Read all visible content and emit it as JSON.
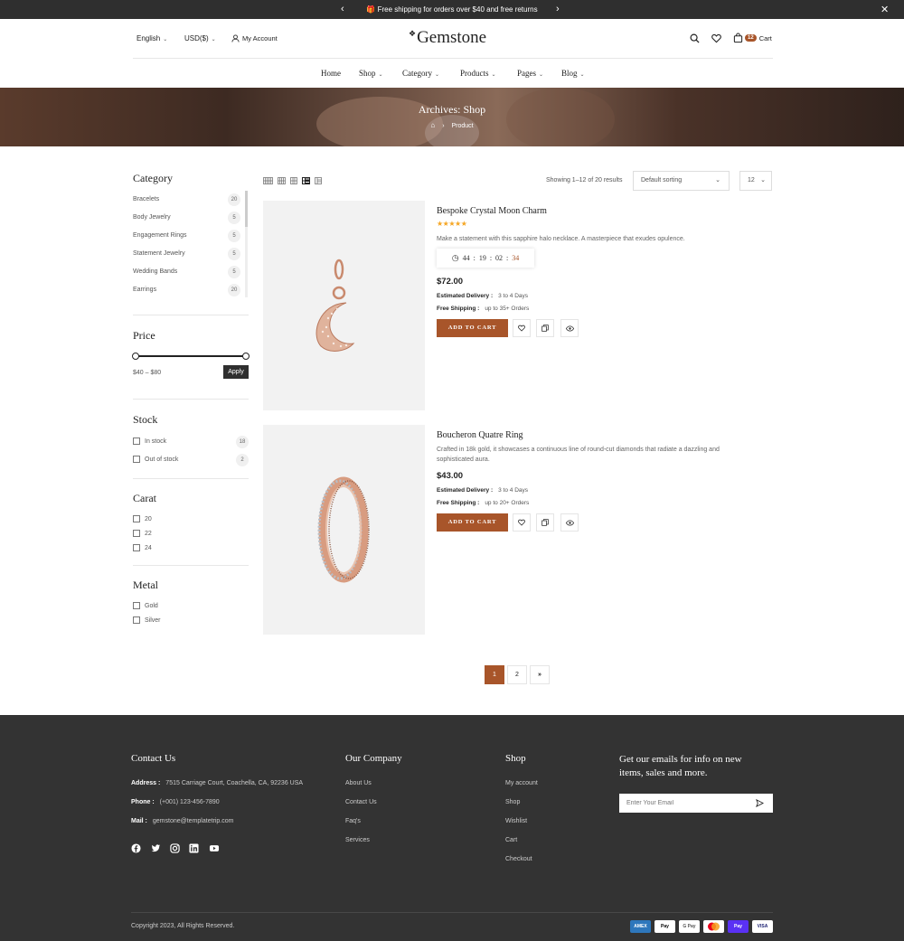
{
  "topbar": {
    "message": "Free shipping for orders over $40 and free returns"
  },
  "header": {
    "language": "English",
    "currency": "USD($)",
    "account": "My Account",
    "logo": "Gemstone",
    "cart_count": "12",
    "cart_label": "Cart"
  },
  "nav": [
    {
      "label": "Home"
    },
    {
      "label": "Shop"
    },
    {
      "label": "Category"
    },
    {
      "label": "Products"
    },
    {
      "label": "Pages"
    },
    {
      "label": "Blog"
    }
  ],
  "hero": {
    "title": "Archives: Shop",
    "breadcrumb_current": "Product"
  },
  "sidebar": {
    "category_title": "Category",
    "categories": [
      {
        "name": "Bracelets",
        "count": "20"
      },
      {
        "name": "Body Jewelry",
        "count": "5"
      },
      {
        "name": "Engagement Rings",
        "count": "5"
      },
      {
        "name": "Statement Jewelry",
        "count": "5"
      },
      {
        "name": "Wedding Bands",
        "count": "5"
      },
      {
        "name": "Earrings",
        "count": "20"
      }
    ],
    "price_title": "Price",
    "price_range": "$40 – $80",
    "apply_label": "Apply",
    "stock_title": "Stock",
    "stock": [
      {
        "name": "In stock",
        "count": "18"
      },
      {
        "name": "Out of stock",
        "count": "2"
      }
    ],
    "carat_title": "Carat",
    "carat": [
      "20",
      "22",
      "24"
    ],
    "metal_title": "Metal",
    "metal": [
      "Gold",
      "Silver"
    ]
  },
  "toolbar": {
    "showing": "Showing 1–12 of 20 results",
    "sorting": "Default sorting",
    "per_page": "12"
  },
  "products": [
    {
      "title": "Bespoke Crystal Moon Charm",
      "rating": 5,
      "description": "Make a statement with this sapphire halo necklace. A masterpiece that exudes opulence.",
      "countdown": {
        "d": "44",
        "h": "19",
        "m": "02",
        "s": "34"
      },
      "price": "$72.00",
      "delivery_label": "Estimated Delivery :",
      "delivery_value": "3 to 4 Days",
      "shipping_label": "Free Shipping :",
      "shipping_value": "up to 35+ Orders",
      "cart_label": "ADD TO CART"
    },
    {
      "title": "Boucheron Quatre Ring",
      "description": "Crafted in 18k gold, it showcases a continuous line of round-cut diamonds that radiate a dazzling and sophisticated aura.",
      "price": "$43.00",
      "delivery_label": "Estimated Delivery :",
      "delivery_value": "3 to 4 Days",
      "shipping_label": "Free Shipping :",
      "shipping_value": "up to 20+ Orders",
      "cart_label": "ADD TO CART"
    }
  ],
  "pagination": {
    "pages": [
      "1",
      "2"
    ],
    "next": "»"
  },
  "footer": {
    "contact_title": "Contact Us",
    "address_label": "Address :",
    "address": "7515 Carriage Court, Coachella, CA, 92236 USA",
    "phone_label": "Phone :",
    "phone": "(+001) 123-456-7890",
    "mail_label": "Mail :",
    "mail": "gemstone@templatetrip.com",
    "company_title": "Our Company",
    "company_links": [
      "About Us",
      "Contact Us",
      "Faq's",
      "Services"
    ],
    "shop_title": "Shop",
    "shop_links": [
      "My account",
      "Shop",
      "Wishlist",
      "Cart",
      "Checkout"
    ],
    "newsletter_title_1": "Get our emails for info on new",
    "newsletter_title_2": "items, sales and more.",
    "email_placeholder": "Enter Your Email",
    "copyright": "Copyright 2023, All Rights Reserved.",
    "payments": [
      "AMEX",
      "Pay",
      "G Pay",
      "MC",
      "Pay",
      "VISA"
    ]
  },
  "colors": {
    "accent": "#a8552a",
    "dark": "#333333",
    "star": "#f5a623"
  }
}
